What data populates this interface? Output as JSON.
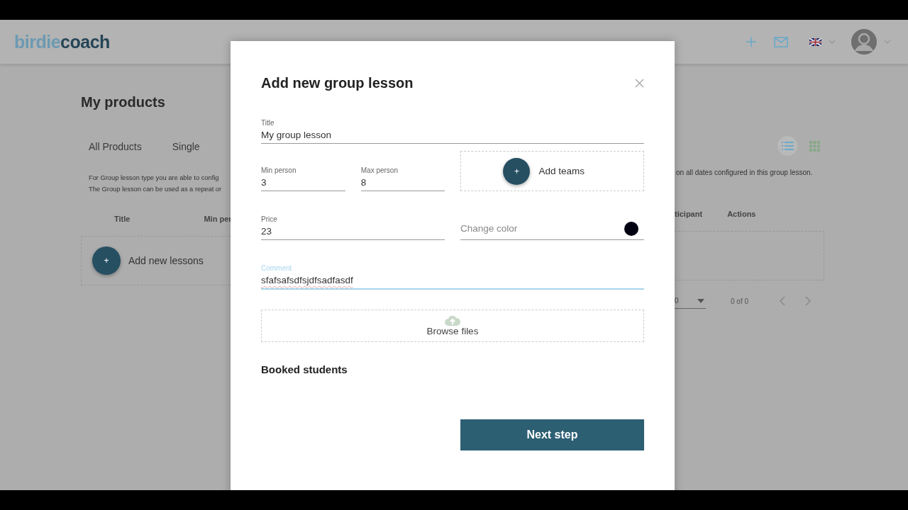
{
  "header": {
    "logo": [
      "birdie",
      "coach"
    ]
  },
  "page": {
    "title": "My products",
    "tabs": [
      {
        "label": "All Products",
        "selected": false
      },
      {
        "label": "Single",
        "selected": false
      }
    ],
    "view_toggles": [
      {
        "kind": "list",
        "selected": true
      },
      {
        "kind": "grid",
        "selected": false
      }
    ],
    "description_left": [
      "For Group lesson type you are able to config",
      "The Group lesson can be used as a repeat or"
    ],
    "description_right": "on all dates configured in this group lesson.",
    "table": {
      "columns_left": [
        "Title",
        "Min per"
      ],
      "columns_right": [
        "ticipant",
        "Actions"
      ]
    },
    "add_icon": "+",
    "add_button": "Add new lessons",
    "pagination": {
      "per_page": "0",
      "range": "0 of 0"
    }
  },
  "modal": {
    "title": "Add new group lesson",
    "title_field": {
      "label": "Title",
      "value": "My group lesson"
    },
    "min_person": {
      "label": "Min person",
      "value": "3"
    },
    "max_person": {
      "label": "Max person",
      "value": "8"
    },
    "add_teams_icon": "+",
    "add_teams": "Add teams",
    "price": {
      "label": "Price",
      "value": "23"
    },
    "change_color": {
      "placeholder": "Change color",
      "color": "#000011"
    },
    "comment": {
      "label": "Comment",
      "value": "sfafsafsdfsjdfsadfasdf",
      "focused": true
    },
    "browse_files": "Browse files",
    "booked_students": "Booked students",
    "next_button": "Next step"
  }
}
